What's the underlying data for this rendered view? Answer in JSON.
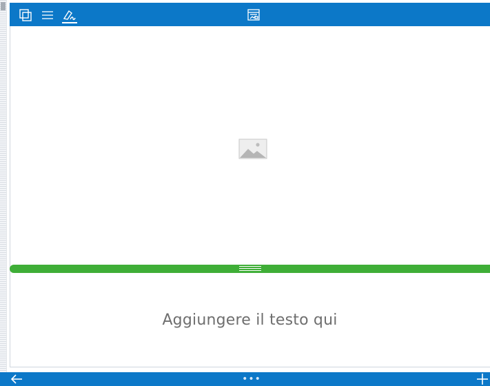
{
  "toolbar": {
    "icons": [
      "layers-icon",
      "menu-icon",
      "pen-icon",
      "presentation-icon"
    ],
    "active_icon": "pen-icon"
  },
  "content": {
    "image_placeholder_icon": "image-icon",
    "text_placeholder": "Aggiungere il testo qui"
  },
  "divider": {
    "color": "#3fae37",
    "handle_icon": "drag-handle-icon"
  },
  "bottombar": {
    "back_icon": "arrow-left-icon",
    "more_label": "•••",
    "add_icon": "plus-icon"
  },
  "colors": {
    "accent": "#0c78c8",
    "divider": "#3fae37",
    "placeholder_text": "#6e6e6e"
  }
}
